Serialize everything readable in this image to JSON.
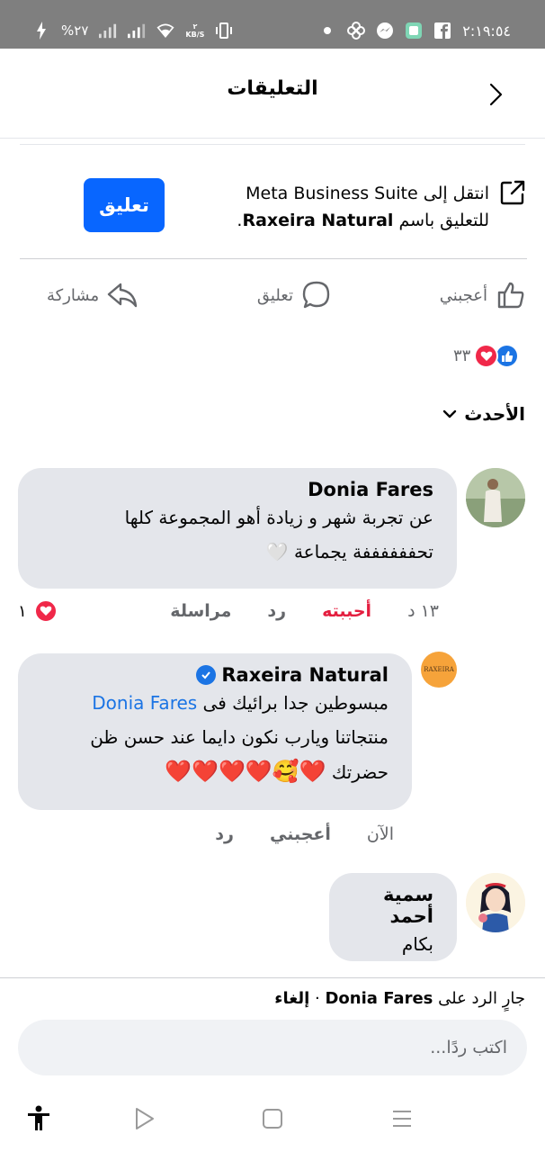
{
  "status_bar": {
    "time": "٢:١٩:٥٤",
    "battery": "%٢٧",
    "net_speed": "٢",
    "net_unit": "KB/S"
  },
  "header": {
    "title": "التعليقات"
  },
  "business_suite": {
    "line1": "انتقل إلى Meta Business Suite",
    "line2_prefix": "للتعليق باسم ",
    "line2_name": "Raxeira Natural",
    "line2_suffix": ".",
    "button_label": "تعليق"
  },
  "actions": {
    "like_label": "أعجبني",
    "comment_label": "تعليق",
    "share_label": "مشاركة"
  },
  "reactions": {
    "count": "٣٣"
  },
  "sort": {
    "label": "الأحدث"
  },
  "comments": [
    {
      "author": "Donia Fares",
      "line1": "عن تجربة شهر و زيادة أهو المجموعة كلها",
      "line2": "تحففففففة يجماعة",
      "emoji": "🤍",
      "time": "١٣ د",
      "like_label": "أحببته",
      "reply_label": "رد",
      "message_label": "مراسلة",
      "love_count": "١"
    },
    {
      "author": "Raxeira Natural",
      "avatar_text": "RAXEIRA",
      "line1_prefix": "مبسوطين جدا برائيك فى ",
      "mention": "Donia Fares",
      "line2": "منتجاتنا ويارب نكون دايما عند حسن ظن",
      "line3": "حضرتك",
      "emoji": "❤️🥰❤️❤️❤️❤️",
      "time": "الآن",
      "like_label": "أعجبني",
      "reply_label": "رد"
    },
    {
      "author": "سمية أحمد",
      "line1": "بكام"
    }
  ],
  "reply_bar": {
    "prefix": "جارٍ الرد على ",
    "name": "Donia Fares",
    "separator": " · ",
    "cancel": "إلغاء",
    "placeholder": "اكتب ردًا..."
  },
  "colors": {
    "brand_blue": "#0866ff",
    "love_red": "#f02849",
    "bubble_gray": "#e4e6eb"
  }
}
